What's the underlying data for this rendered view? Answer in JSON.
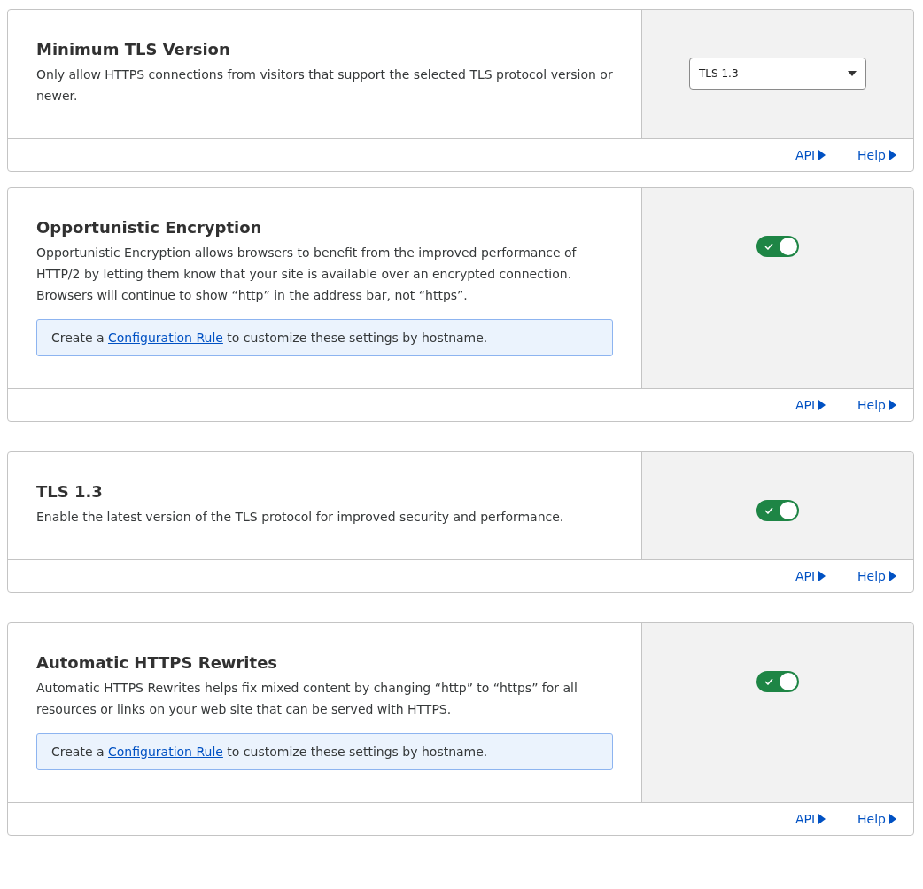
{
  "settings": [
    {
      "title": "Minimum TLS Version",
      "description": "Only allow HTTPS connections from visitors that support the selected TLS protocol version or newer.",
      "control": {
        "kind": "select",
        "value": "TLS 1.3"
      },
      "links": [
        "API",
        "Help"
      ]
    },
    {
      "title": "Opportunistic Encryption",
      "description": "Opportunistic Encryption allows browsers to benefit from the improved performance of HTTP/2 by letting them know that your site is available over an encrypted connection. Browsers will continue to show “http” in the address bar, not “https”.",
      "note": {
        "before": "Create a",
        "link": "Configuration Rule",
        "after": "to customize these settings by hostname."
      },
      "control": {
        "kind": "toggle",
        "on": true
      },
      "links": [
        "API",
        "Help"
      ]
    },
    {
      "title": "TLS 1.3",
      "description": "Enable the latest version of the TLS protocol for improved security and performance.",
      "control": {
        "kind": "toggle",
        "on": true
      },
      "links": [
        "API",
        "Help"
      ]
    },
    {
      "title": "Automatic HTTPS Rewrites",
      "description": "Automatic HTTPS Rewrites helps fix mixed content by changing “http” to “https” for all resources or links on your web site that can be served with HTTPS.",
      "note": {
        "before": "Create a",
        "link": "Configuration Rule",
        "after": "to customize these settings by hostname."
      },
      "control": {
        "kind": "toggle",
        "on": true
      },
      "links": [
        "API",
        "Help"
      ]
    }
  ]
}
